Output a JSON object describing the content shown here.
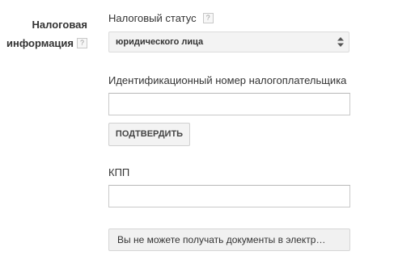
{
  "section": {
    "label_line1": "Налоговая",
    "label_line2": "информация",
    "help": "?"
  },
  "tax_status": {
    "label": "Налоговый статус",
    "help": "?",
    "selected": "юридического лица"
  },
  "inn": {
    "label": "Идентификационный номер налогоплательщика",
    "value": ""
  },
  "confirm_button": {
    "label": "ПОДТВЕРДИТЬ"
  },
  "kpp": {
    "label": "КПП",
    "value": ""
  },
  "documents_notice": {
    "text": "Вы не можете получать документы в электр…"
  }
}
